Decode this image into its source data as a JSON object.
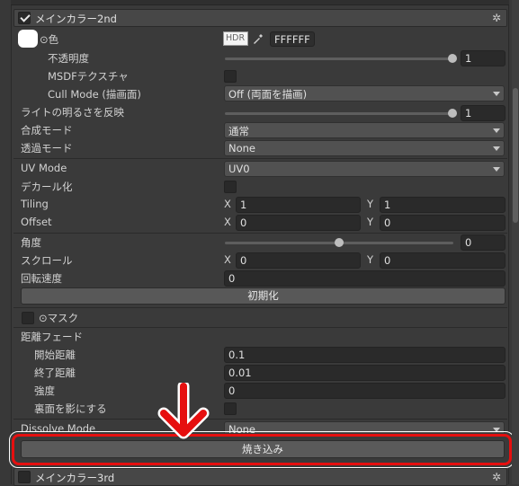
{
  "sections": {
    "main2": {
      "title": "メインカラー2nd",
      "enabled": true
    },
    "main3": {
      "title": "メインカラー3rd",
      "enabled": false
    }
  },
  "color": {
    "label": "⊙色",
    "hdr": "HDR",
    "hex": "FFFFFF",
    "swatch": "#ffffff"
  },
  "opacity": {
    "label": "不透明度",
    "value": "1",
    "slider_fraction": 1.0
  },
  "msdf": {
    "label": "MSDFテクスチャ",
    "checked": false
  },
  "cull": {
    "label": "Cull Mode (描画面)",
    "value": "Off (両面を描画)"
  },
  "light": {
    "label": "ライトの明るさを反映",
    "value": "1",
    "slider_fraction": 1.0
  },
  "blend": {
    "label": "合成モード",
    "value": "通常"
  },
  "alpha": {
    "label": "透過モード",
    "value": "None"
  },
  "uvmode": {
    "label": "UV Mode",
    "value": "UV0"
  },
  "decal": {
    "label": "デカール化",
    "checked": false
  },
  "tiling": {
    "label": "Tiling",
    "x_label": "X",
    "x": "1",
    "y_label": "Y",
    "y": "1"
  },
  "offset": {
    "label": "Offset",
    "x_label": "X",
    "x": "0",
    "y_label": "Y",
    "y": "0"
  },
  "angle": {
    "label": "角度",
    "value": "0",
    "slider_fraction": 0.5
  },
  "scroll": {
    "label": "スクロール",
    "x_label": "X",
    "x": "0",
    "y_label": "Y",
    "y": "0"
  },
  "rotspeed": {
    "label": "回転速度",
    "value": "0"
  },
  "reset": {
    "label": "初期化"
  },
  "mask": {
    "label": "⊙マスク",
    "checked": false
  },
  "distfade": {
    "label": "距離フェード",
    "start_label": "開始距離",
    "start": "0.1",
    "end_label": "終了距離",
    "end": "0.01",
    "strength_label": "強度",
    "strength": "0",
    "backface_label": "裏面を影にする",
    "backface_checked": false
  },
  "dissolve": {
    "label": "Dissolve Mode",
    "value": "None"
  },
  "bake": {
    "label": "焼き込み"
  },
  "annotation": {
    "arrow_color": "#e60f0f",
    "highlight_color": "#e60f0f"
  }
}
